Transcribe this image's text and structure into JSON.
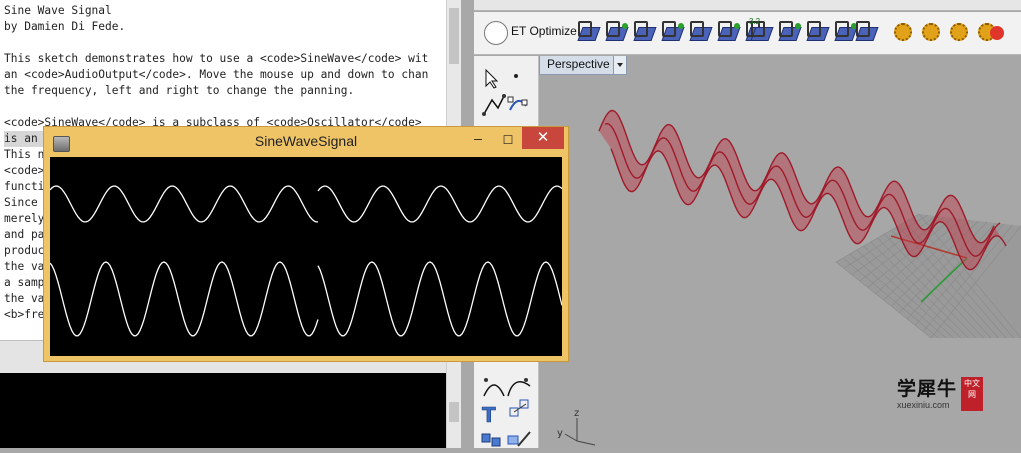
{
  "editor": {
    "lines": [
      "Sine Wave Signal",
      "by Damien Di Fede.",
      "",
      "This sketch demonstrates how to use a <code>SineWave</code> wit",
      "an <code>AudioOutput</code>. Move the mouse up and down to chan",
      "the frequency, left and right to change the panning.",
      "",
      "<code>SineWave</code> is a subclass of <code>Oscillator</code>",
      "is an",
      "This n",
      "<code>",
      "functi",
      "Since ",
      "merely",
      "and pa",
      "produc",
      "the va",
      "a samp",
      "the va",
      "<b>fre"
    ]
  },
  "window": {
    "title": "SineWaveSignal",
    "min_glyph": "–",
    "max_glyph": "☐",
    "close_glyph": "✕",
    "wave_color": "#ffffff",
    "titlebar_color": "#efc467"
  },
  "rhino": {
    "ribbon_label": "ET Optimize",
    "badge_label": "3.2",
    "viewport_name": "Perspective",
    "axis_z": "z",
    "axis_y": "y",
    "surface_color": "#c0394a"
  },
  "watermark": {
    "chinese": "学犀牛",
    "badge": "中文网",
    "url": "xuexiniu.com"
  }
}
